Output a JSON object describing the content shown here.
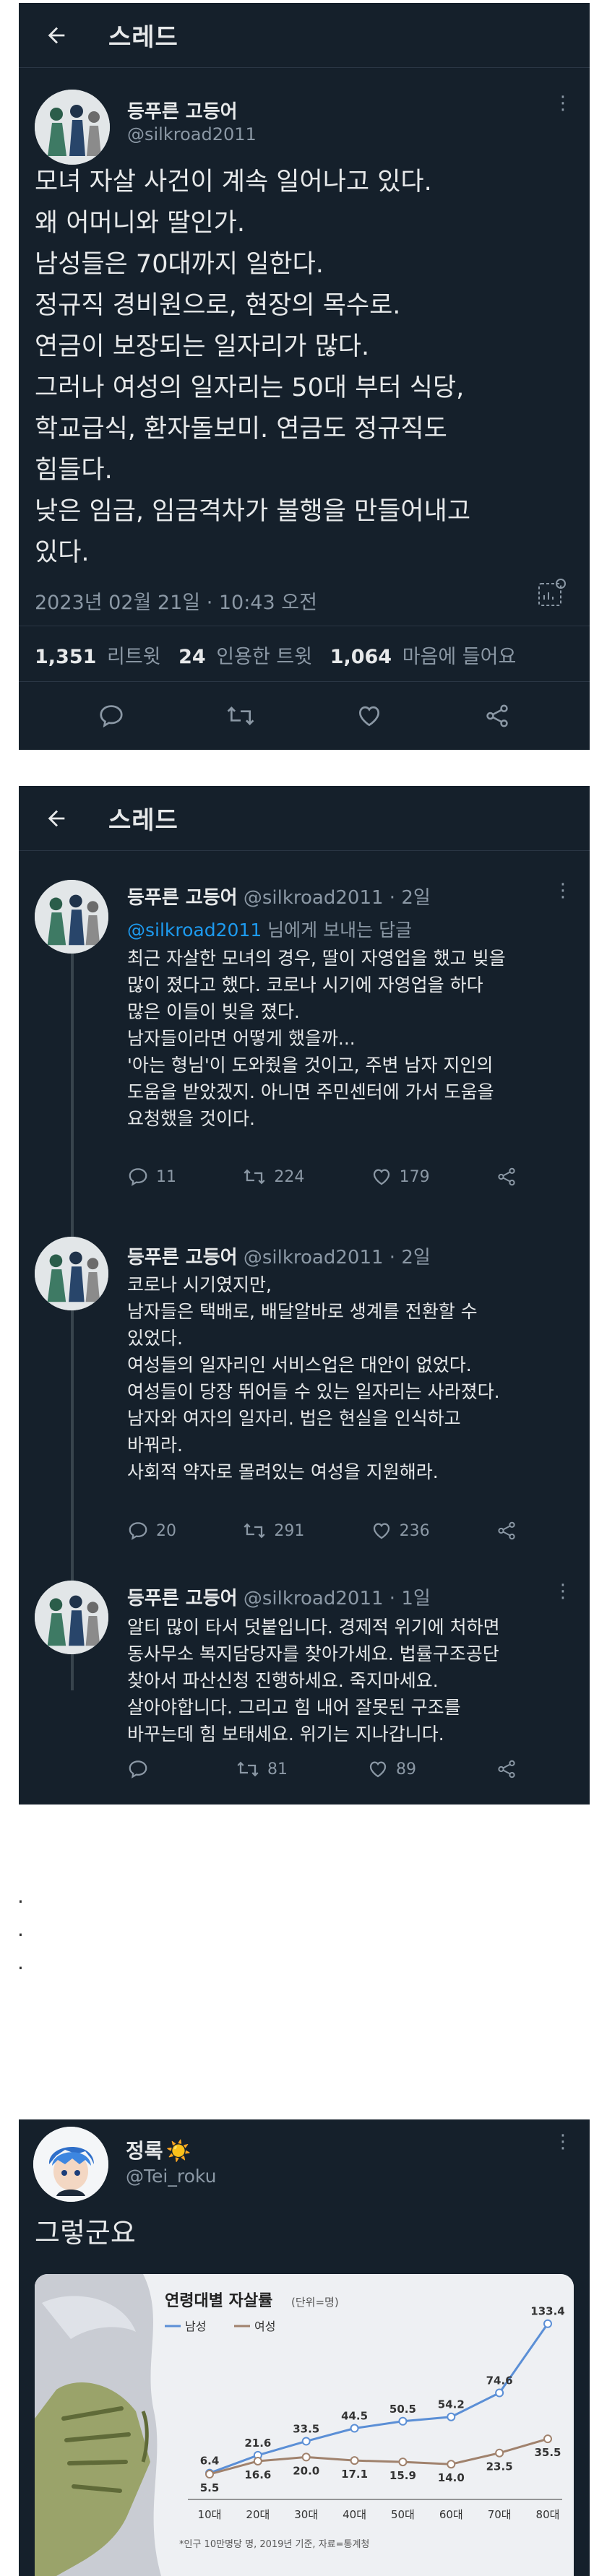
{
  "thread1": {
    "header_title": "스레드",
    "author_name": "등푸른 고등어",
    "author_handle": "@silkroad2011",
    "lines": [
      "모녀 자살 사건이 계속 일어나고 있다.",
      "왜 어머니와 딸인가.",
      "남성들은 70대까지 일한다.",
      "정규직 경비원으로, 현장의 목수로.",
      "연금이 보장되는 일자리가 많다.",
      "그러나 여성의 일자리는 50대 부터 식당,",
      "학교급식, 환자돌보미. 연금도 정규직도",
      "힘들다.",
      "낮은 임금, 임금격차가 불행을 만들어내고",
      "있다."
    ],
    "timestamp": "2023년 02월 21일 · 10:43 오전",
    "stats": {
      "retweets_count": "1,351",
      "retweets_label": "리트윗",
      "quotes_count": "24",
      "quotes_label": "인용한 트윗",
      "likes_count": "1,064",
      "likes_label": "마음에 들어요"
    }
  },
  "thread2": {
    "header_title": "스레드",
    "replies": [
      {
        "author_name": "등푸른 고등어",
        "author_handle": "@silkroad2011",
        "age": "· 2일",
        "replying_prefix": "@silkroad2011",
        "replying_suffix": " 님에게 보내는 답글",
        "lines": [
          "최근 자살한 모녀의 경우, 딸이 자영업을 했고 빚을",
          "많이 졌다고 했다. 코로나 시기에 자영업을 하다",
          "많은 이들이 빚을 졌다.",
          "남자들이라면 어떻게 했을까...",
          "'아는 형님'이 도와줬을 것이고, 주변 남자 지인의",
          "도움을 받았겠지.  아니면 주민센터에 가서 도움을",
          "요청했을 것이다."
        ],
        "replies_count": "11",
        "retweets_count": "224",
        "likes_count": "179"
      },
      {
        "author_name": "등푸른 고등어",
        "author_handle": "@silkroad2011",
        "age": "· 2일",
        "lines": [
          "코로나 시기였지만,",
          "남자들은 택배로, 배달알바로 생계를 전환할 수",
          "있었다.",
          "여성들의 일자리인 서비스업은 대안이 없었다.",
          "여성들이 당장 뛰어들 수 있는 일자리는 사라졌다.",
          "남자와 여자의 일자리. 법은 현실을 인식하고",
          "바꿔라.",
          "사회적 약자로 몰려있는 여성을 지원해라."
        ],
        "replies_count": "20",
        "retweets_count": "291",
        "likes_count": "236"
      },
      {
        "author_name": "등푸른 고등어",
        "author_handle": "@silkroad2011",
        "age": "· 1일",
        "lines": [
          "알티 많이 타서 덧붙입니다. 경제적 위기에 처하면",
          "동사무소 복지담당자를 찾아가세요. 법률구조공단",
          "찾아서 파산신청 진행하세요. 죽지마세요.",
          "살아야합니다. 그리고 힘 내어 잘못된 구조를",
          "바꾸는데 힘 보태세요. 위기는 지나갑니다."
        ],
        "replies_count": "",
        "retweets_count": "81",
        "likes_count": "89"
      }
    ]
  },
  "separator_dots": [
    ".",
    ".",
    "."
  ],
  "thread3": {
    "author_name": "정록",
    "author_badge": "☀️",
    "author_handle": "@Tei_roku",
    "text": "그렇군요"
  },
  "chart_data": {
    "type": "line",
    "title": "연령대별 자살률",
    "unit_note": "(단위=명)",
    "categories": [
      "10대",
      "20대",
      "30대",
      "40대",
      "50대",
      "60대",
      "70대",
      "80대"
    ],
    "series": [
      {
        "name": "남성",
        "color": "#5b8fd6",
        "values": [
          6.4,
          21.6,
          33.5,
          44.5,
          50.5,
          54.2,
          74.6,
          133.4
        ]
      },
      {
        "name": "여성",
        "color": "#a0826d",
        "values": [
          5.5,
          16.6,
          20.0,
          17.1,
          15.9,
          14.0,
          23.5,
          35.5
        ]
      }
    ],
    "value_labels_male": [
      "6.4",
      "21.6",
      "33.5",
      "44.5",
      "50.5",
      "54.2",
      "74.6",
      "133.4"
    ],
    "value_labels_female": [
      "5.5",
      "16.6",
      "20.0",
      "17.1",
      "15.9",
      "14.0",
      "23.5",
      "35.5"
    ],
    "ylim": [
      0,
      140
    ],
    "grid": false,
    "legend_placement": "top-left",
    "footnote": "*인구 10만명당 명, 2019년 기준, 자료=통계청"
  },
  "colors": {
    "background": "#15202b",
    "text": "#e7e9ea",
    "muted": "#8b98a5",
    "link": "#1d9bf0",
    "page": "#ffffff"
  }
}
